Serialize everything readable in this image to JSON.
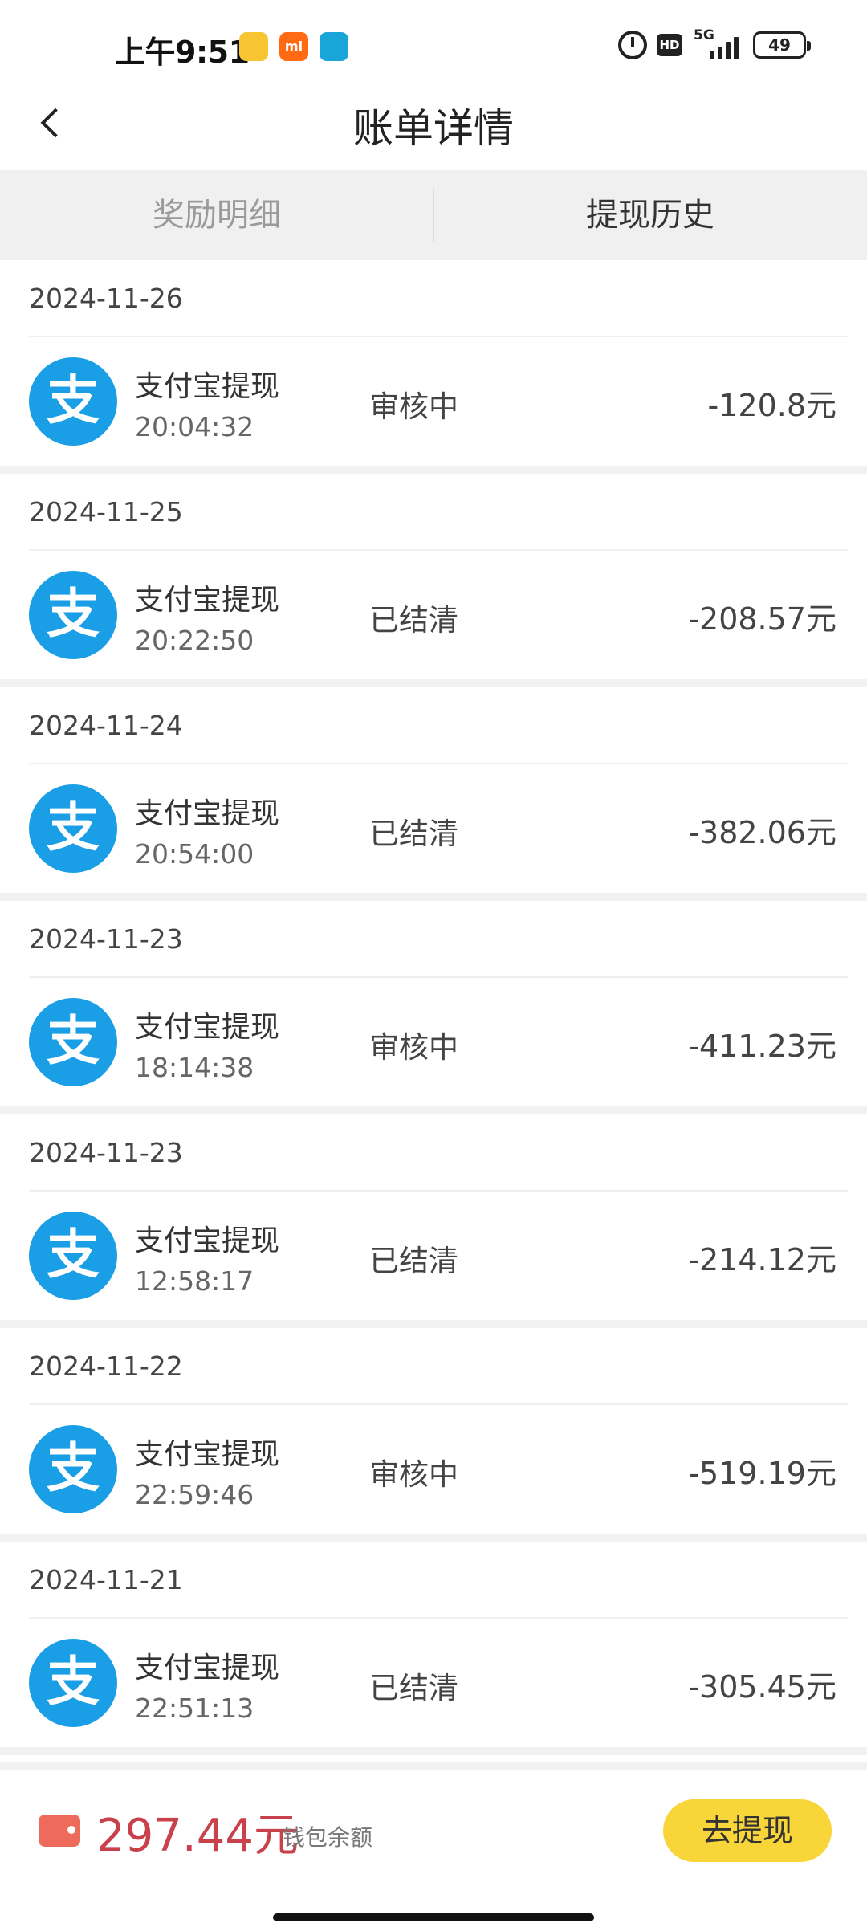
{
  "status_bar": {
    "time": "上午9:51",
    "network": "5G",
    "hd": "HD",
    "battery": "49"
  },
  "header": {
    "title": "账单详情"
  },
  "tabs": [
    {
      "label": "奖励明细",
      "active": false
    },
    {
      "label": "提现历史",
      "active": true
    }
  ],
  "transactions": [
    {
      "date": "2024-11-26",
      "name": "支付宝提现",
      "time": "20:04:32",
      "status": "审核中",
      "amount": "-120.8元"
    },
    {
      "date": "2024-11-25",
      "name": "支付宝提现",
      "time": "20:22:50",
      "status": "已结清",
      "amount": "-208.57元"
    },
    {
      "date": "2024-11-24",
      "name": "支付宝提现",
      "time": "20:54:00",
      "status": "已结清",
      "amount": "-382.06元"
    },
    {
      "date": "2024-11-23",
      "name": "支付宝提现",
      "time": "18:14:38",
      "status": "审核中",
      "amount": "-411.23元"
    },
    {
      "date": "2024-11-23",
      "name": "支付宝提现",
      "time": "12:58:17",
      "status": "已结清",
      "amount": "-214.12元"
    },
    {
      "date": "2024-11-22",
      "name": "支付宝提现",
      "time": "22:59:46",
      "status": "审核中",
      "amount": "-519.19元"
    },
    {
      "date": "2024-11-21",
      "name": "支付宝提现",
      "time": "22:51:13",
      "status": "已结清",
      "amount": "-305.45元"
    }
  ],
  "alipay_logo_glyph": "支",
  "bottom": {
    "balance": "297.44元",
    "balance_label": "钱包余额",
    "withdraw_label": "去提现"
  },
  "colors": {
    "alipay_blue": "#1a9ee6",
    "balance_red": "#c8414b",
    "button_yellow": "#f8d63a"
  }
}
